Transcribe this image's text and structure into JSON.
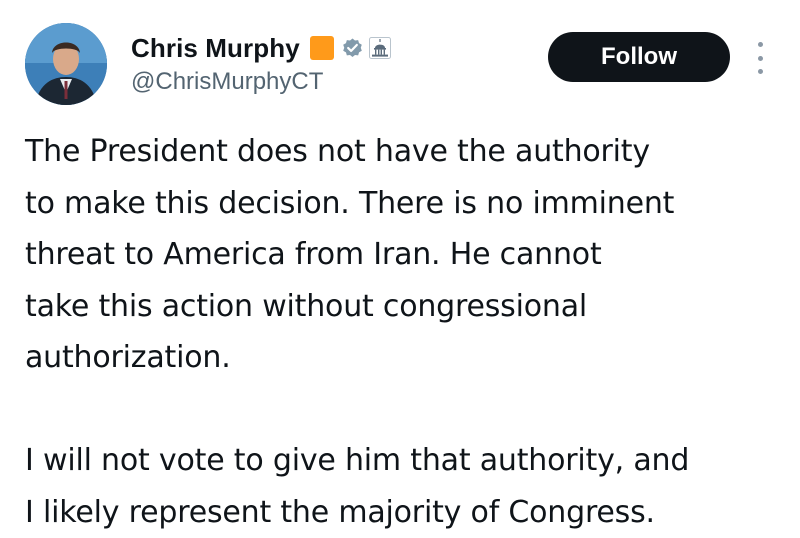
{
  "author": {
    "display_name": "Chris Murphy",
    "handle": "@ChrisMurphyCT",
    "badges": [
      "orange-square-emoji",
      "verified-checkmark-icon",
      "capitol-building-icon"
    ]
  },
  "actions": {
    "follow_label": "Follow",
    "more_icon": "more-options-icon"
  },
  "tweet": {
    "lines_p1": [
      "The President does not have the authority",
      "to make this decision. There is no imminent",
      "threat to America from Iran. He cannot",
      "take this action without congressional",
      "authorization."
    ],
    "lines_p2": [
      "I will not vote to give him that authority, and",
      "I likely represent the majority of Congress."
    ]
  },
  "colors": {
    "text": "#0f1419",
    "secondary_text": "#536471",
    "follow_button": "#0f1419",
    "orange_badge": "#ff9a1a",
    "verified_badge": "#829aab"
  }
}
